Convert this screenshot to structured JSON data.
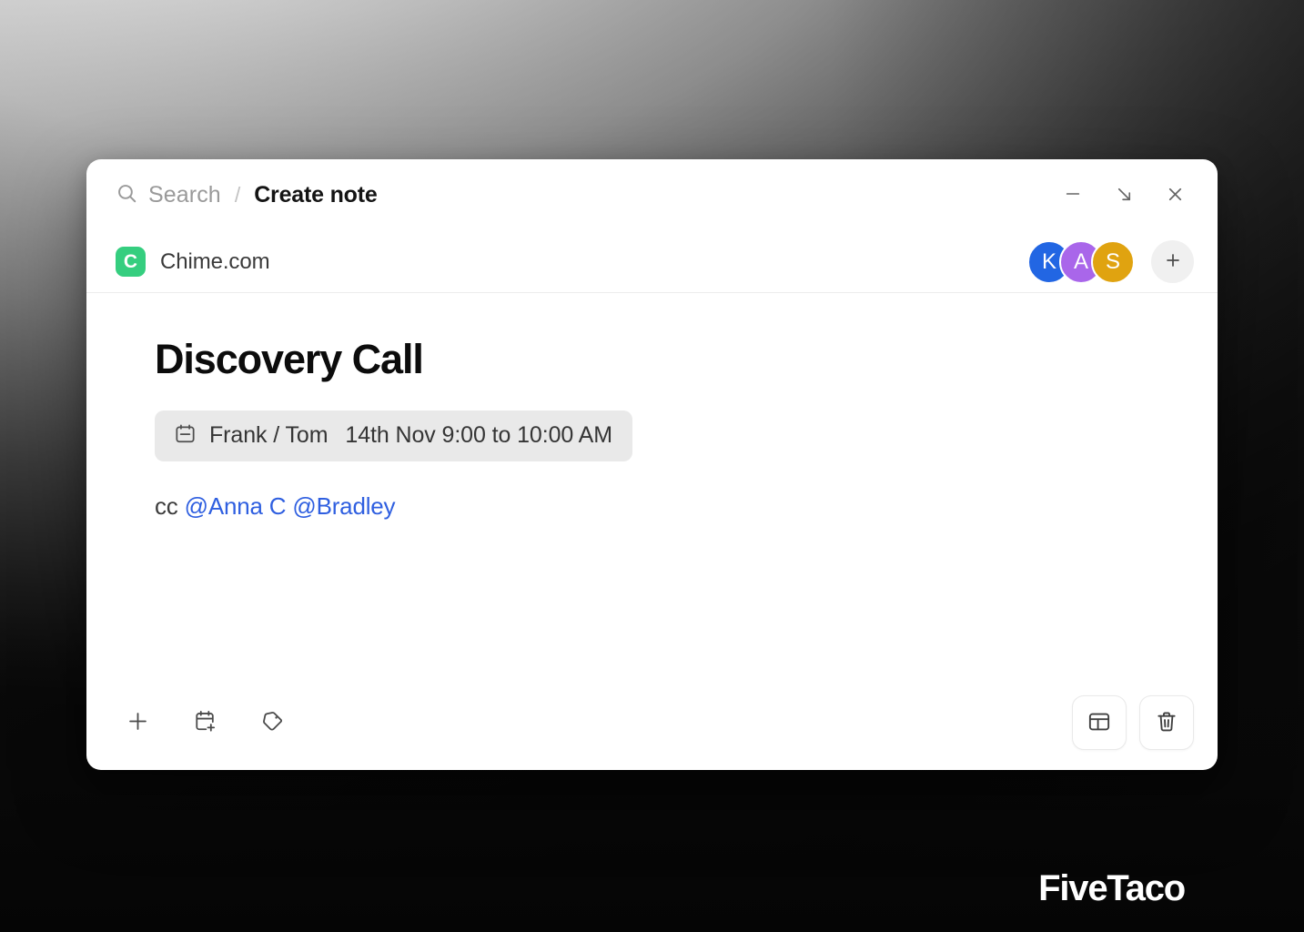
{
  "titlebar": {
    "search_placeholder": "Search",
    "separator": "/",
    "current_page": "Create note",
    "controls": [
      {
        "name": "minimize",
        "label": "Minimize"
      },
      {
        "name": "collapse",
        "label": "Collapse"
      },
      {
        "name": "close",
        "label": "Close"
      }
    ]
  },
  "siterow": {
    "favicon_letter": "C",
    "favicon_color": "#35ce7f",
    "site_name": "Chime.com",
    "avatars": [
      {
        "initial": "K",
        "color": "#2266e3"
      },
      {
        "initial": "A",
        "color": "#a966ea"
      },
      {
        "initial": "S",
        "color": "#e0a310"
      }
    ],
    "add_person_label": "+"
  },
  "note": {
    "title": "Discovery Call",
    "event_chip": {
      "icon": "calendar-icon",
      "people": "Frank / Tom",
      "when": "14th Nov 9:00 to 10:00 AM"
    },
    "cc_label": "cc",
    "mentions": [
      "@Anna C",
      "@Bradley"
    ],
    "mention_color": "#2f5fe0"
  },
  "footer": {
    "left_tools": [
      {
        "name": "add",
        "icon": "plus-icon"
      },
      {
        "name": "schedule",
        "icon": "calendar-plus-icon"
      },
      {
        "name": "tag",
        "icon": "tag-icon"
      }
    ],
    "right_tools": [
      {
        "name": "layout",
        "icon": "layout-panel-icon"
      },
      {
        "name": "delete",
        "icon": "trash-icon"
      }
    ]
  },
  "watermark": {
    "text": "FiveTaco"
  }
}
